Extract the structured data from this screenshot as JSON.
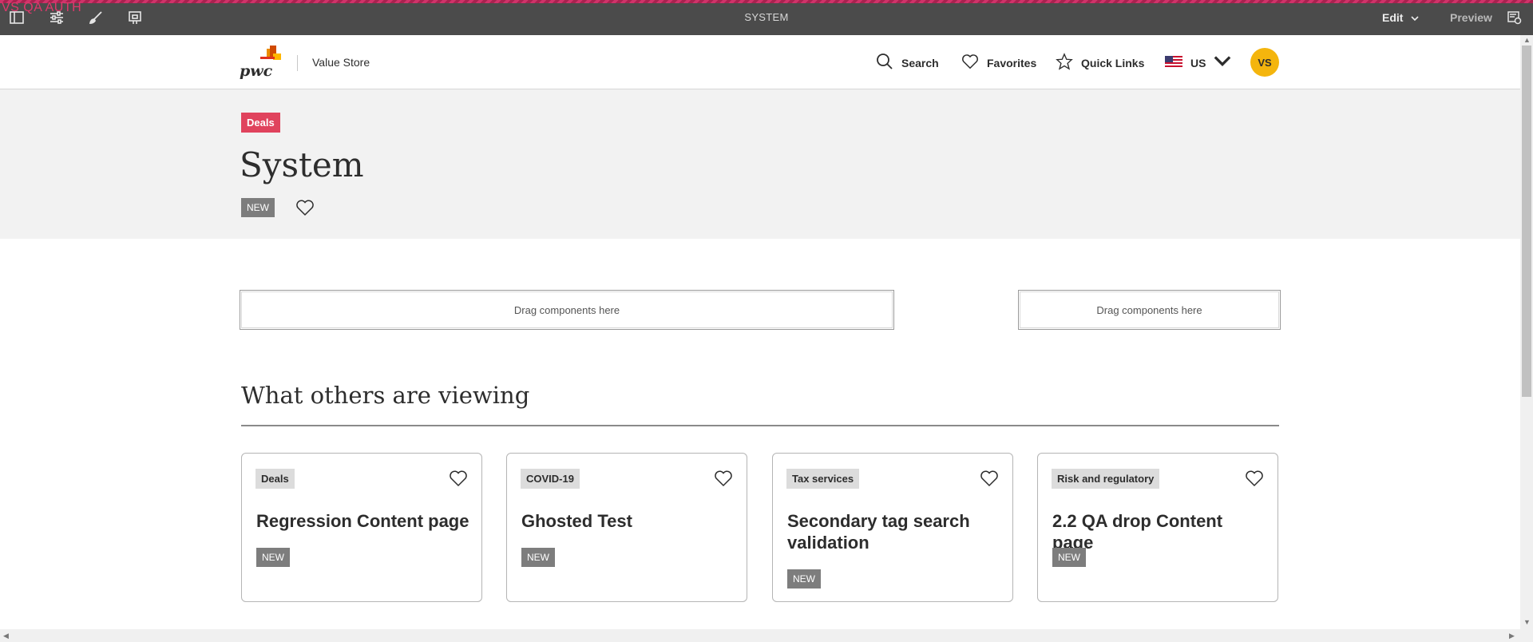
{
  "editor": {
    "env_label": "VS QA AUTH",
    "page_title": "SYSTEM",
    "mode_label": "Edit",
    "preview_label": "Preview",
    "icons": [
      "side-panel-icon",
      "page-properties-icon",
      "paint-brush-icon",
      "annotations-icon",
      "emulator-icon"
    ]
  },
  "header": {
    "site_name": "Value Store",
    "nav": {
      "search": "Search",
      "favorites": "Favorites",
      "quick_links": "Quick Links",
      "locale": "US"
    },
    "avatar_initials": "VS"
  },
  "hero": {
    "tag": "Deals",
    "title": "System",
    "badge": "NEW"
  },
  "dropzones": [
    {
      "label": "Drag components here"
    },
    {
      "label": "Drag components here"
    }
  ],
  "section": {
    "title": "What others are viewing",
    "cards": [
      {
        "tag": "Deals",
        "title": "Regression Content page",
        "badge": "NEW"
      },
      {
        "tag": "COVID-19",
        "title": "Ghosted Test",
        "badge": "NEW"
      },
      {
        "tag": "Tax services",
        "title": "Secondary tag search validation",
        "badge": "NEW"
      },
      {
        "tag": "Risk and regulatory",
        "title": "2.2 QA drop Content page",
        "badge": "NEW"
      }
    ]
  },
  "colors": {
    "deals_tag": "#e0435d",
    "avatar": "#f4b50d",
    "editor_bar": "#4b4b4b",
    "hero_bg": "#f2f2f2"
  }
}
